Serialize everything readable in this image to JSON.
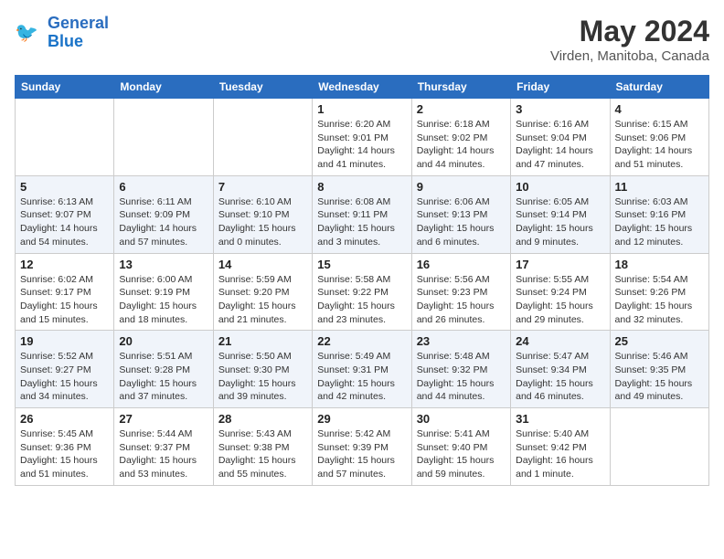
{
  "header": {
    "logo_line1": "General",
    "logo_line2": "Blue",
    "month": "May 2024",
    "location": "Virden, Manitoba, Canada"
  },
  "weekdays": [
    "Sunday",
    "Monday",
    "Tuesday",
    "Wednesday",
    "Thursday",
    "Friday",
    "Saturday"
  ],
  "weeks": [
    [
      {
        "day": "",
        "info": ""
      },
      {
        "day": "",
        "info": ""
      },
      {
        "day": "",
        "info": ""
      },
      {
        "day": "1",
        "info": "Sunrise: 6:20 AM\nSunset: 9:01 PM\nDaylight: 14 hours and 41 minutes."
      },
      {
        "day": "2",
        "info": "Sunrise: 6:18 AM\nSunset: 9:02 PM\nDaylight: 14 hours and 44 minutes."
      },
      {
        "day": "3",
        "info": "Sunrise: 6:16 AM\nSunset: 9:04 PM\nDaylight: 14 hours and 47 minutes."
      },
      {
        "day": "4",
        "info": "Sunrise: 6:15 AM\nSunset: 9:06 PM\nDaylight: 14 hours and 51 minutes."
      }
    ],
    [
      {
        "day": "5",
        "info": "Sunrise: 6:13 AM\nSunset: 9:07 PM\nDaylight: 14 hours and 54 minutes."
      },
      {
        "day": "6",
        "info": "Sunrise: 6:11 AM\nSunset: 9:09 PM\nDaylight: 14 hours and 57 minutes."
      },
      {
        "day": "7",
        "info": "Sunrise: 6:10 AM\nSunset: 9:10 PM\nDaylight: 15 hours and 0 minutes."
      },
      {
        "day": "8",
        "info": "Sunrise: 6:08 AM\nSunset: 9:11 PM\nDaylight: 15 hours and 3 minutes."
      },
      {
        "day": "9",
        "info": "Sunrise: 6:06 AM\nSunset: 9:13 PM\nDaylight: 15 hours and 6 minutes."
      },
      {
        "day": "10",
        "info": "Sunrise: 6:05 AM\nSunset: 9:14 PM\nDaylight: 15 hours and 9 minutes."
      },
      {
        "day": "11",
        "info": "Sunrise: 6:03 AM\nSunset: 9:16 PM\nDaylight: 15 hours and 12 minutes."
      }
    ],
    [
      {
        "day": "12",
        "info": "Sunrise: 6:02 AM\nSunset: 9:17 PM\nDaylight: 15 hours and 15 minutes."
      },
      {
        "day": "13",
        "info": "Sunrise: 6:00 AM\nSunset: 9:19 PM\nDaylight: 15 hours and 18 minutes."
      },
      {
        "day": "14",
        "info": "Sunrise: 5:59 AM\nSunset: 9:20 PM\nDaylight: 15 hours and 21 minutes."
      },
      {
        "day": "15",
        "info": "Sunrise: 5:58 AM\nSunset: 9:22 PM\nDaylight: 15 hours and 23 minutes."
      },
      {
        "day": "16",
        "info": "Sunrise: 5:56 AM\nSunset: 9:23 PM\nDaylight: 15 hours and 26 minutes."
      },
      {
        "day": "17",
        "info": "Sunrise: 5:55 AM\nSunset: 9:24 PM\nDaylight: 15 hours and 29 minutes."
      },
      {
        "day": "18",
        "info": "Sunrise: 5:54 AM\nSunset: 9:26 PM\nDaylight: 15 hours and 32 minutes."
      }
    ],
    [
      {
        "day": "19",
        "info": "Sunrise: 5:52 AM\nSunset: 9:27 PM\nDaylight: 15 hours and 34 minutes."
      },
      {
        "day": "20",
        "info": "Sunrise: 5:51 AM\nSunset: 9:28 PM\nDaylight: 15 hours and 37 minutes."
      },
      {
        "day": "21",
        "info": "Sunrise: 5:50 AM\nSunset: 9:30 PM\nDaylight: 15 hours and 39 minutes."
      },
      {
        "day": "22",
        "info": "Sunrise: 5:49 AM\nSunset: 9:31 PM\nDaylight: 15 hours and 42 minutes."
      },
      {
        "day": "23",
        "info": "Sunrise: 5:48 AM\nSunset: 9:32 PM\nDaylight: 15 hours and 44 minutes."
      },
      {
        "day": "24",
        "info": "Sunrise: 5:47 AM\nSunset: 9:34 PM\nDaylight: 15 hours and 46 minutes."
      },
      {
        "day": "25",
        "info": "Sunrise: 5:46 AM\nSunset: 9:35 PM\nDaylight: 15 hours and 49 minutes."
      }
    ],
    [
      {
        "day": "26",
        "info": "Sunrise: 5:45 AM\nSunset: 9:36 PM\nDaylight: 15 hours and 51 minutes."
      },
      {
        "day": "27",
        "info": "Sunrise: 5:44 AM\nSunset: 9:37 PM\nDaylight: 15 hours and 53 minutes."
      },
      {
        "day": "28",
        "info": "Sunrise: 5:43 AM\nSunset: 9:38 PM\nDaylight: 15 hours and 55 minutes."
      },
      {
        "day": "29",
        "info": "Sunrise: 5:42 AM\nSunset: 9:39 PM\nDaylight: 15 hours and 57 minutes."
      },
      {
        "day": "30",
        "info": "Sunrise: 5:41 AM\nSunset: 9:40 PM\nDaylight: 15 hours and 59 minutes."
      },
      {
        "day": "31",
        "info": "Sunrise: 5:40 AM\nSunset: 9:42 PM\nDaylight: 16 hours and 1 minute."
      },
      {
        "day": "",
        "info": ""
      }
    ]
  ]
}
